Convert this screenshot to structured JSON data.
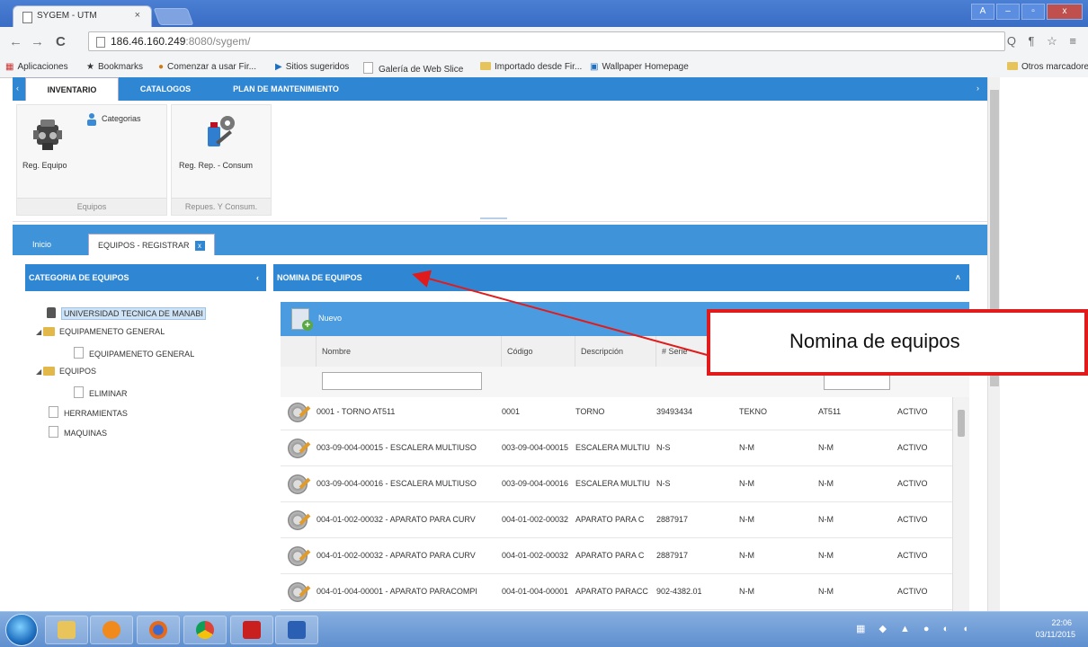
{
  "browser": {
    "tab_title": "SYGEM - UTM",
    "tab_close": "×",
    "url_host": "186.46.160.249",
    "url_rest": ":8080/sygem/",
    "nav_back": "←",
    "nav_forward": "→",
    "nav_reload": "C",
    "addr_icons": "Q ¶ ☆ ≡",
    "window_controls": [
      "A",
      "–",
      "▫",
      "x"
    ]
  },
  "bookmarks": {
    "apps": "Aplicaciones",
    "items": [
      "Bookmarks",
      "Comenzar a usar Fir...",
      "Sitios sugeridos",
      "Galería de Web Slice",
      "Importado desde Fir...",
      "Wallpaper Homepage"
    ],
    "other": "Otros marcadores"
  },
  "ribbon": {
    "tabs": [
      "INVENTARIO",
      "CATALOGOS",
      "PLAN DE MANTENIMIENTO"
    ],
    "active_tab": "INVENTARIO",
    "group1": {
      "caption": "Equipos",
      "btn_main": "Reg. Equipo",
      "btn_small": "Categorias"
    },
    "group2": {
      "caption": "Repues. Y Consum.",
      "btn_main": "Reg. Rep. - Consum"
    }
  },
  "main_tabs": {
    "home": "Inicio",
    "active": "EQUIPOS - REGISTRAR"
  },
  "left_panel": {
    "title": "CATEGORIA DE EQUIPOS",
    "collapse": "‹",
    "tree": [
      {
        "label": "UNIVERSIDAD TECNICA DE MANABI"
      },
      {
        "label": "EQUIPAMENETO GENERAL"
      },
      {
        "label": "EQUIPAMENETO GENERAL"
      },
      {
        "label": "EQUIPOS"
      },
      {
        "label": "ELIMINAR"
      },
      {
        "label": "HERRAMIENTAS"
      },
      {
        "label": "MAQUINAS"
      }
    ]
  },
  "right_panel": {
    "title": "NOMINA DE EQUIPOS",
    "collapse": "˄",
    "new_button": "Nuevo",
    "columns": [
      "Nombre",
      "Código",
      "Descripción",
      "# Serie"
    ],
    "rows": [
      [
        "0001 - TORNO AT511",
        "0001",
        "TORNO",
        "39493434",
        "TEKNO",
        "AT511",
        "ACTIVO"
      ],
      [
        "003-09-004-00015 - ESCALERA MULTIUSO",
        "003-09-004-00015",
        "ESCALERA MULTIU",
        "N-S",
        "N-M",
        "N-M",
        "ACTIVO"
      ],
      [
        "003-09-004-00016 - ESCALERA MULTIUSO",
        "003-09-004-00016",
        "ESCALERA MULTIU",
        "N-S",
        "N-M",
        "N-M",
        "ACTIVO"
      ],
      [
        "004-01-002-00032 - APARATO PARA CURV",
        "004-01-002-00032",
        "APARATO PARA C",
        "2887917",
        "N-M",
        "N-M",
        "ACTIVO"
      ],
      [
        "004-01-002-00032 - APARATO PARA CURV",
        "004-01-002-00032",
        "APARATO PARA C",
        "2887917",
        "N-M",
        "N-M",
        "ACTIVO"
      ],
      [
        "004-01-004-00001 - APARATO PARACOMPI",
        "004-01-004-00001",
        "APARATO PARACC",
        "902-4382.01",
        "N-M",
        "N-M",
        "ACTIVO"
      ]
    ]
  },
  "annotation": {
    "text": "Nomina de equipos",
    "color": "#e11b1b"
  },
  "taskbar": {
    "time": "22:06",
    "date": "03/11/2015"
  },
  "colors": {
    "accent": "#2f86d3",
    "titlebar": "#3a6cc4"
  }
}
